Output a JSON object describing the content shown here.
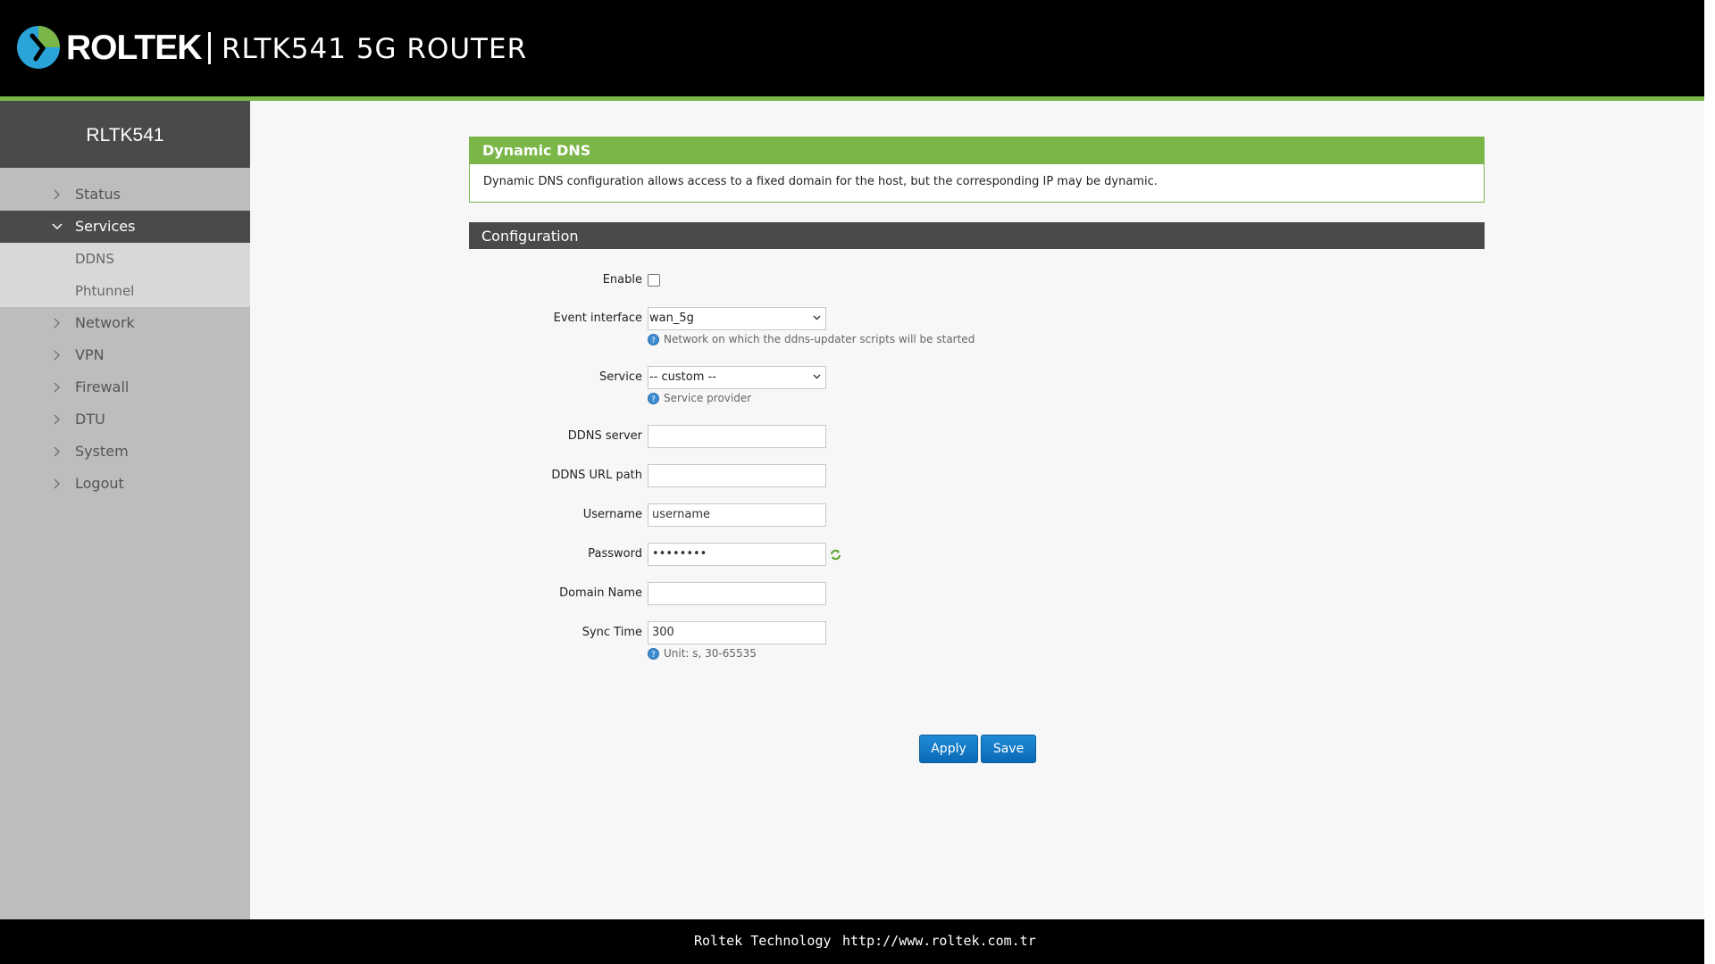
{
  "header": {
    "brand": "ROLTEK",
    "product_title": "RLTK541 5G ROUTER",
    "logo_icon": "roltek-logo-icon",
    "accent_color": "#7ab648"
  },
  "sidebar": {
    "title": "RLTK541",
    "items": [
      {
        "label": "Status",
        "icon": "chevron-right-icon",
        "expanded": false
      },
      {
        "label": "Services",
        "icon": "chevron-down-icon",
        "expanded": true,
        "children": [
          {
            "label": "DDNS"
          },
          {
            "label": "Phtunnel"
          }
        ]
      },
      {
        "label": "Network",
        "icon": "chevron-right-icon",
        "expanded": false
      },
      {
        "label": "VPN",
        "icon": "chevron-right-icon",
        "expanded": false
      },
      {
        "label": "Firewall",
        "icon": "chevron-right-icon",
        "expanded": false
      },
      {
        "label": "DTU",
        "icon": "chevron-right-icon",
        "expanded": false
      },
      {
        "label": "System",
        "icon": "chevron-right-icon",
        "expanded": false
      },
      {
        "label": "Logout",
        "icon": "chevron-right-icon",
        "expanded": false
      }
    ]
  },
  "main": {
    "section_title": "Dynamic DNS",
    "section_description": "Dynamic DNS configuration allows access to a fixed domain for the host, but the corresponding IP may be dynamic.",
    "config_title": "Configuration",
    "form": {
      "enable": {
        "label": "Enable",
        "checked": false
      },
      "event_interface": {
        "label": "Event interface",
        "value": "wan_5g",
        "hint": "Network on which the ddns-updater scripts will be started"
      },
      "service": {
        "label": "Service",
        "value": "-- custom --",
        "hint": "Service provider"
      },
      "ddns_server": {
        "label": "DDNS server",
        "value": ""
      },
      "ddns_url_path": {
        "label": "DDNS URL path",
        "value": ""
      },
      "username": {
        "label": "Username",
        "value": "username"
      },
      "password": {
        "label": "Password",
        "value": "••••••••"
      },
      "domain_name": {
        "label": "Domain Name",
        "value": ""
      },
      "sync_time": {
        "label": "Sync Time",
        "value": "300",
        "hint": "Unit: s, 30-65535"
      }
    },
    "buttons": {
      "apply": "Apply",
      "save": "Save"
    }
  },
  "footer": {
    "company": "Roltek Technology",
    "url": "http://www.roltek.com.tr"
  }
}
